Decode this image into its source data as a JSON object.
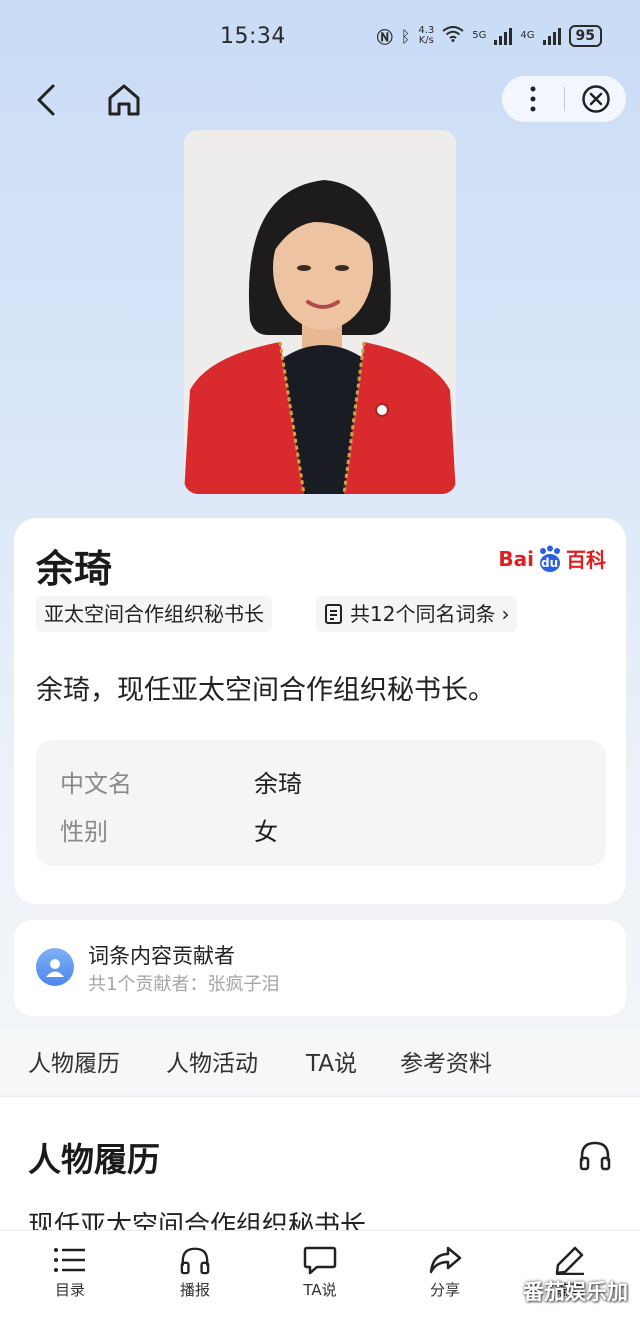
{
  "status_bar": {
    "time": "15:34",
    "speed_top": "4.3",
    "speed_bottom": "K/s",
    "net1": "5G",
    "net2": "4G",
    "battery": "95"
  },
  "nav": {
    "back_icon": "chevron-left-icon",
    "home_icon": "home-icon",
    "more_icon": "more-vertical-icon",
    "close_icon": "close-circle-icon"
  },
  "entry": {
    "name": "余琦",
    "logo_left": "Bai",
    "logo_mid": "du",
    "logo_right": "百科",
    "tag": "亚太空间合作组织秘书长",
    "same_name": "共12个同名词条",
    "same_name_arrow": "›",
    "summary": "余琦，现任亚太空间合作组织秘书长。",
    "attributes": [
      {
        "key": "中文名",
        "value": "余琦"
      },
      {
        "key": "性别",
        "value": "女"
      }
    ]
  },
  "contributors": {
    "title": "词条内容贡献者",
    "subtitle": "共1个贡献者：张疯子泪"
  },
  "tabs": [
    "人物履历",
    "人物活动",
    "TA说",
    "参考资料"
  ],
  "section": {
    "title": "人物履历",
    "text": "现任亚太空间合作组织秘书长"
  },
  "bottom_bar": [
    {
      "label": "目录",
      "icon": "menu-list-icon"
    },
    {
      "label": "播报",
      "icon": "headphones-icon"
    },
    {
      "label": "TA说",
      "icon": "chat-bubble-icon"
    },
    {
      "label": "分享",
      "icon": "share-icon"
    },
    {
      "label": "编辑",
      "icon": "edit-pencil-icon"
    }
  ],
  "watermark": "番茄娱乐加",
  "colors": {
    "brand_red": "#e02020",
    "brand_blue": "#2a5fe0",
    "accent_blue": "#4d86ee"
  }
}
